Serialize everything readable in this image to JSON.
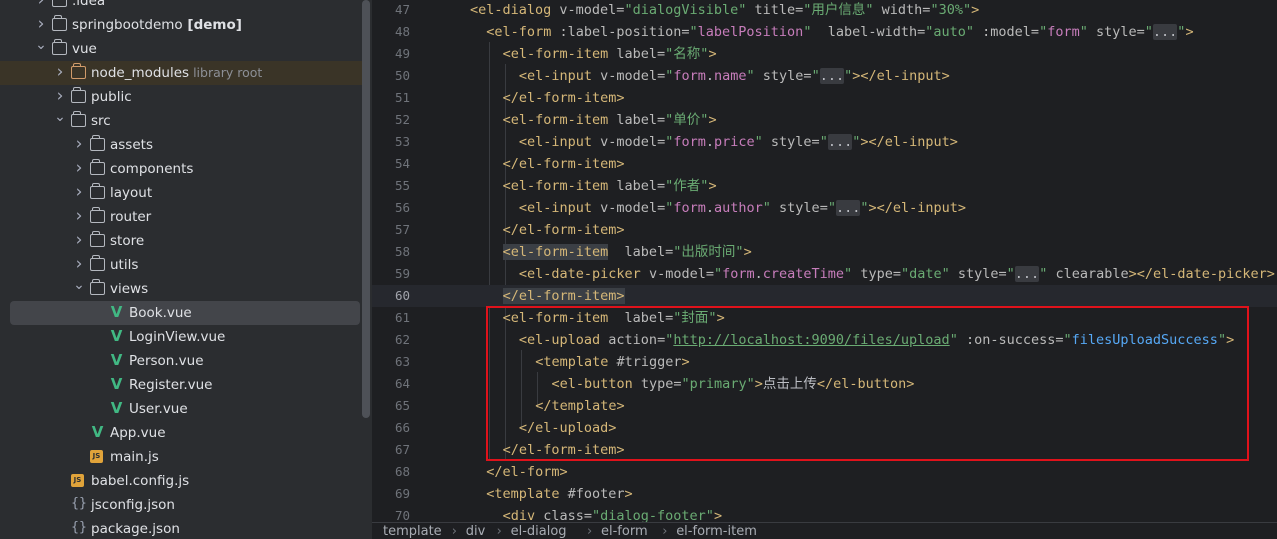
{
  "tree": {
    "rows": [
      {
        "label": ".idea",
        "kind": "folder",
        "indent": 0,
        "expanded": false
      },
      {
        "label": "springbootdemo",
        "bold_suffix": "[demo]",
        "kind": "module",
        "indent": 0,
        "expanded": false
      },
      {
        "label": "vue",
        "kind": "folder",
        "indent": 0,
        "expanded": true
      },
      {
        "label": "node_modules",
        "hint": "library root",
        "kind": "library",
        "indent": 1,
        "expanded": false
      },
      {
        "label": "public",
        "kind": "folder",
        "indent": 1,
        "expanded": false
      },
      {
        "label": "src",
        "kind": "folder",
        "indent": 1,
        "expanded": true
      },
      {
        "label": "assets",
        "kind": "folder",
        "indent": 2,
        "expanded": false
      },
      {
        "label": "components",
        "kind": "folder",
        "indent": 2,
        "expanded": false
      },
      {
        "label": "layout",
        "kind": "folder",
        "indent": 2,
        "expanded": false
      },
      {
        "label": "router",
        "kind": "folder",
        "indent": 2,
        "expanded": false
      },
      {
        "label": "store",
        "kind": "folder",
        "indent": 2,
        "expanded": false
      },
      {
        "label": "utils",
        "kind": "folder",
        "indent": 2,
        "expanded": false
      },
      {
        "label": "views",
        "kind": "folder",
        "indent": 2,
        "expanded": true
      },
      {
        "label": "Book.vue",
        "kind": "vue",
        "indent": 3,
        "selected": true
      },
      {
        "label": "LoginView.vue",
        "kind": "vue",
        "indent": 3
      },
      {
        "label": "Person.vue",
        "kind": "vue",
        "indent": 3
      },
      {
        "label": "Register.vue",
        "kind": "vue",
        "indent": 3
      },
      {
        "label": "User.vue",
        "kind": "vue",
        "indent": 3
      },
      {
        "label": "App.vue",
        "kind": "vue",
        "indent": 2
      },
      {
        "label": "main.js",
        "kind": "js",
        "indent": 2
      },
      {
        "label": "babel.config.js",
        "kind": "js",
        "indent": 1
      },
      {
        "label": "jsconfig.json",
        "kind": "json",
        "indent": 1
      },
      {
        "label": "package.json",
        "kind": "json",
        "indent": 1
      }
    ]
  },
  "editor": {
    "current_line": 60,
    "lines": [
      {
        "n": 47,
        "indent": 6,
        "tokens": [
          [
            "tag",
            "<el-dialog "
          ],
          [
            "attr",
            "v-model="
          ],
          [
            "str",
            "\"dialogVisible\""
          ],
          [
            "attr",
            " title="
          ],
          [
            "str",
            "\"用户信息\""
          ],
          [
            "attr",
            " width="
          ],
          [
            "str",
            "\"30%\""
          ],
          [
            "tag",
            ">"
          ]
        ]
      },
      {
        "n": 48,
        "indent": 8,
        "tokens": [
          [
            "tag",
            "<el-form "
          ],
          [
            "attr",
            ":label-position="
          ],
          [
            "str",
            "\""
          ],
          [
            "var",
            "labelPosition"
          ],
          [
            "str",
            "\""
          ],
          [
            "attr",
            "  label-width="
          ],
          [
            "str",
            "\"auto\""
          ],
          [
            "attr",
            " :model="
          ],
          [
            "str",
            "\""
          ],
          [
            "var",
            "form"
          ],
          [
            "str",
            "\""
          ],
          [
            "attr",
            " style="
          ],
          [
            "str",
            "\""
          ],
          [
            "fold",
            "..."
          ],
          [
            "str",
            "\""
          ],
          [
            "tag",
            ">"
          ]
        ]
      },
      {
        "n": 49,
        "indent": 10,
        "tokens": [
          [
            "tag",
            "<el-form-item "
          ],
          [
            "attr",
            "label="
          ],
          [
            "str",
            "\"名称\""
          ],
          [
            "tag",
            ">"
          ]
        ]
      },
      {
        "n": 50,
        "indent": 12,
        "tokens": [
          [
            "tag",
            "<el-input "
          ],
          [
            "attr",
            "v-model="
          ],
          [
            "str",
            "\""
          ],
          [
            "var",
            "form"
          ],
          [
            "txt",
            "."
          ],
          [
            "var",
            "name"
          ],
          [
            "str",
            "\""
          ],
          [
            "attr",
            " style="
          ],
          [
            "str",
            "\""
          ],
          [
            "fold",
            "..."
          ],
          [
            "str",
            "\""
          ],
          [
            "tag",
            "></el-input>"
          ]
        ]
      },
      {
        "n": 51,
        "indent": 10,
        "tokens": [
          [
            "tag",
            "</el-form-item>"
          ]
        ]
      },
      {
        "n": 52,
        "indent": 10,
        "tokens": [
          [
            "tag",
            "<el-form-item "
          ],
          [
            "attr",
            "label="
          ],
          [
            "str",
            "\"单价\""
          ],
          [
            "tag",
            ">"
          ]
        ]
      },
      {
        "n": 53,
        "indent": 12,
        "tokens": [
          [
            "tag",
            "<el-input "
          ],
          [
            "attr",
            "v-model="
          ],
          [
            "str",
            "\""
          ],
          [
            "var",
            "form"
          ],
          [
            "txt",
            "."
          ],
          [
            "var",
            "price"
          ],
          [
            "str",
            "\""
          ],
          [
            "attr",
            " style="
          ],
          [
            "str",
            "\""
          ],
          [
            "fold",
            "..."
          ],
          [
            "str",
            "\""
          ],
          [
            "tag",
            "></el-input>"
          ]
        ]
      },
      {
        "n": 54,
        "indent": 10,
        "tokens": [
          [
            "tag",
            "</el-form-item>"
          ]
        ]
      },
      {
        "n": 55,
        "indent": 10,
        "tokens": [
          [
            "tag",
            "<el-form-item "
          ],
          [
            "attr",
            "label="
          ],
          [
            "str",
            "\"作者\""
          ],
          [
            "tag",
            ">"
          ]
        ]
      },
      {
        "n": 56,
        "indent": 12,
        "tokens": [
          [
            "tag",
            "<el-input "
          ],
          [
            "attr",
            "v-model="
          ],
          [
            "str",
            "\""
          ],
          [
            "var",
            "form"
          ],
          [
            "txt",
            "."
          ],
          [
            "var",
            "author"
          ],
          [
            "str",
            "\""
          ],
          [
            "attr",
            " style="
          ],
          [
            "str",
            "\""
          ],
          [
            "fold",
            "..."
          ],
          [
            "str",
            "\""
          ],
          [
            "tag",
            "></el-input>"
          ]
        ]
      },
      {
        "n": 57,
        "indent": 10,
        "tokens": [
          [
            "tag",
            "</el-form-item>"
          ]
        ]
      },
      {
        "n": 58,
        "indent": 10,
        "tokens": [
          [
            "taghl",
            "<el-form-item"
          ],
          [
            "attr",
            "  label="
          ],
          [
            "str",
            "\"出版时间\""
          ],
          [
            "tag",
            ">"
          ]
        ]
      },
      {
        "n": 59,
        "indent": 12,
        "tokens": [
          [
            "tag",
            "<el-date-picker "
          ],
          [
            "attr",
            "v-model="
          ],
          [
            "str",
            "\""
          ],
          [
            "var",
            "form"
          ],
          [
            "txt",
            "."
          ],
          [
            "var",
            "createTime"
          ],
          [
            "str",
            "\""
          ],
          [
            "attr",
            " type="
          ],
          [
            "str",
            "\"date\""
          ],
          [
            "attr",
            " style="
          ],
          [
            "str",
            "\""
          ],
          [
            "fold",
            "..."
          ],
          [
            "str",
            "\""
          ],
          [
            "attr",
            " clearable"
          ],
          [
            "tag",
            "></el-date-picker>"
          ]
        ]
      },
      {
        "n": 60,
        "indent": 10,
        "tokens": [
          [
            "taghl",
            "</el-form-item>"
          ]
        ]
      },
      {
        "n": 61,
        "indent": 10,
        "tokens": [
          [
            "tag",
            "<el-form-item"
          ],
          [
            "attr",
            "  label="
          ],
          [
            "str",
            "\"封面\""
          ],
          [
            "tag",
            ">"
          ]
        ]
      },
      {
        "n": 62,
        "indent": 12,
        "tokens": [
          [
            "tag",
            "<el-upload "
          ],
          [
            "attr",
            "action="
          ],
          [
            "str",
            "\""
          ],
          [
            "url",
            "http://localhost:9090/files/upload"
          ],
          [
            "str",
            "\""
          ],
          [
            "attr",
            " :on-success="
          ],
          [
            "str",
            "\""
          ],
          [
            "fn",
            "filesUploadSuccess"
          ],
          [
            "str",
            "\""
          ],
          [
            "tag",
            ">"
          ]
        ]
      },
      {
        "n": 63,
        "indent": 14,
        "tokens": [
          [
            "tag",
            "<template "
          ],
          [
            "attr",
            "#trigger"
          ],
          [
            "tag",
            ">"
          ]
        ]
      },
      {
        "n": 64,
        "indent": 16,
        "tokens": [
          [
            "tag",
            "<el-button "
          ],
          [
            "attr",
            "type="
          ],
          [
            "str",
            "\"primary\""
          ],
          [
            "tag",
            ">"
          ],
          [
            "txt",
            "点击上传"
          ],
          [
            "tag",
            "</el-button>"
          ]
        ]
      },
      {
        "n": 65,
        "indent": 14,
        "tokens": [
          [
            "tag",
            "</template>"
          ]
        ]
      },
      {
        "n": 66,
        "indent": 12,
        "tokens": [
          [
            "tag",
            "</el-upload>"
          ]
        ]
      },
      {
        "n": 67,
        "indent": 10,
        "tokens": [
          [
            "tag",
            "</el-form-item>"
          ]
        ]
      },
      {
        "n": 68,
        "indent": 8,
        "tokens": [
          [
            "tag",
            "</el-form>"
          ]
        ]
      },
      {
        "n": 69,
        "indent": 8,
        "tokens": [
          [
            "tag",
            "<template "
          ],
          [
            "attr",
            "#footer"
          ],
          [
            "tag",
            ">"
          ]
        ]
      },
      {
        "n": 70,
        "indent": 10,
        "tokens": [
          [
            "tag",
            "<div "
          ],
          [
            "attr",
            "class="
          ],
          [
            "str",
            "\"dialog-footer\""
          ],
          [
            "tag",
            ">"
          ]
        ]
      }
    ]
  },
  "breadcrumb": [
    "template",
    "div",
    "el-dialog",
    "el-form",
    "el-form-item"
  ]
}
